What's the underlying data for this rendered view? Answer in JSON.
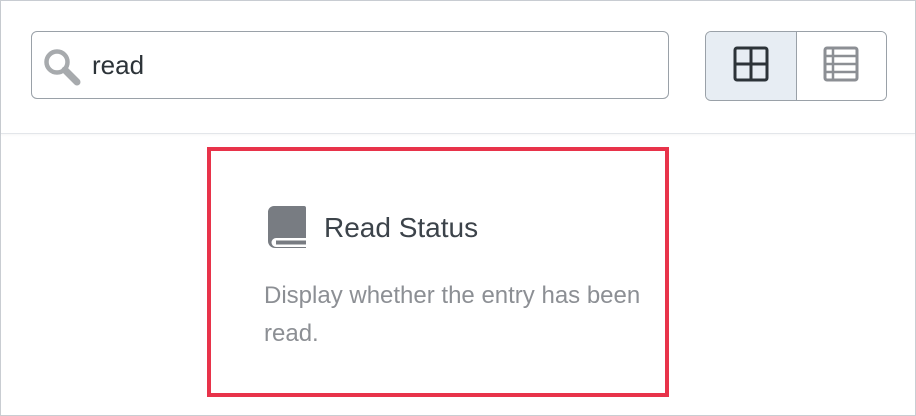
{
  "search": {
    "value": "read",
    "icon": "search-icon"
  },
  "view_toggle": {
    "grid_icon": "grid-icon",
    "list_icon": "list-icon",
    "active": "grid"
  },
  "results": [
    {
      "icon": "book-icon",
      "title": "Read Status",
      "description": "Display whether the entry has been read."
    }
  ],
  "colors": {
    "highlight_border": "#e8334a",
    "icon_gray": "#787c82",
    "active_toggle_bg": "#e7edf3",
    "title_text": "#3c434a",
    "description_text": "#8c8f94"
  }
}
